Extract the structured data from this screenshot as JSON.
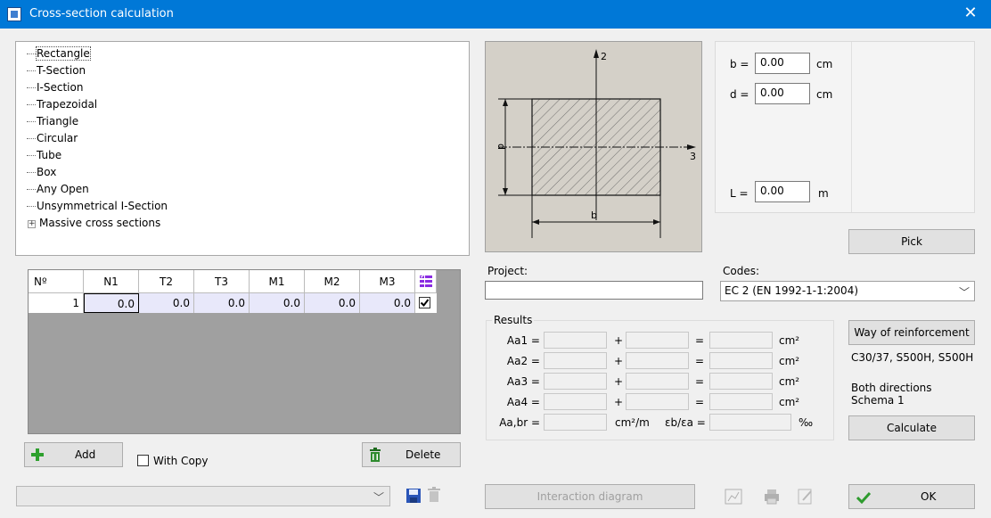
{
  "window": {
    "title": "Cross-section calculation",
    "close": "✕"
  },
  "tree": {
    "items": [
      "Rectangle",
      "T-Section",
      "I-Section",
      "Trapezoidal",
      "Triangle",
      "Circular",
      "Tube",
      "Box",
      "Any Open",
      "Unsymmetrical I-Section"
    ],
    "massive": "Massive cross sections",
    "expander": "+"
  },
  "grid": {
    "headers": [
      "Nº",
      "N1",
      "T2",
      "T3",
      "M1",
      "M2",
      "M3"
    ],
    "row": {
      "index": "1",
      "N1": "0.0",
      "T2": "0.0",
      "T3": "0.0",
      "M1": "0.0",
      "M2": "0.0",
      "M3": "0.0",
      "checked": true
    }
  },
  "actions": {
    "add": "Add",
    "with_copy": "With Copy",
    "delete": "Delete"
  },
  "preview": {
    "axis2": "2",
    "axis3": "3",
    "dim_b": "b",
    "dim_d": "d"
  },
  "dims": {
    "b": {
      "label": "b =",
      "value": "0.00",
      "unit": "cm"
    },
    "d": {
      "label": "d =",
      "value": "0.00",
      "unit": "cm"
    },
    "L": {
      "label": "L =",
      "value": "0.00",
      "unit": "m"
    }
  },
  "pick": "Pick",
  "project": {
    "label": "Project:",
    "value": ""
  },
  "codes": {
    "label": "Codes:",
    "value": "EC 2 (EN 1992-1-1:2004)"
  },
  "results": {
    "title": "Results",
    "rows": [
      {
        "label": "Aa1 =",
        "plus": "+",
        "eq": "=",
        "unit": "cm²"
      },
      {
        "label": "Aa2 =",
        "plus": "+",
        "eq": "=",
        "unit": "cm²"
      },
      {
        "label": "Aa3 =",
        "plus": "+",
        "eq": "=",
        "unit": "cm²"
      },
      {
        "label": "Aa4 =",
        "plus": "+",
        "eq": "=",
        "unit": "cm²"
      }
    ],
    "aabr_label": "Aa,br =",
    "aabr_unit": "cm²/m",
    "eps_label": "εb/εa =",
    "eps_unit": "‰"
  },
  "reinforcement": {
    "button": "Way of reinforcement",
    "materials": "C30/37, S500H, S500H",
    "directions": "Both directions",
    "schema": "Schema 1"
  },
  "calculate": "Calculate",
  "interaction": "Interaction diagram",
  "ok": "OK",
  "colors": {
    "titlebar": "#0078d7",
    "grid_bg": "#a0a0a0",
    "cell_bg": "#e8e8fa",
    "ok_check": "#2e9b2e",
    "add_plus": "#2ea02e"
  }
}
